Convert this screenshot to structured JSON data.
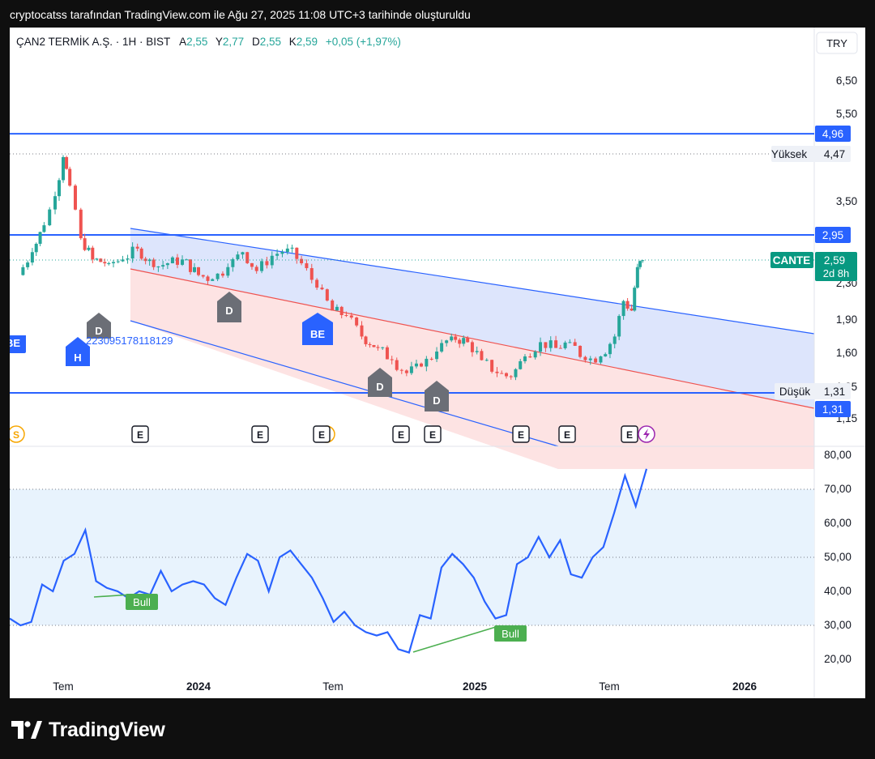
{
  "header": {
    "text": "cryptocatss tarafından TradingView.com ile Ağu 27, 2025 11:08 UTC+3 tarihinde oluşturuldu"
  },
  "brand": {
    "name": "TradingView",
    "icon": "tradingview-logo-icon"
  },
  "chart_data": [
    {
      "type": "candlestick",
      "symbol_line": {
        "name": "ÇAN2 TERMİK A.Ş. · 1H · BIST",
        "open_label": "A",
        "open": "2,55",
        "high_label": "Y",
        "high": "2,77",
        "low_label": "D",
        "low": "2,55",
        "close_label": "K",
        "close": "2,59",
        "change": "+0,05 (+1,97%)"
      },
      "currency": "TRY",
      "y_scale": "log",
      "y_ticks": [
        "6,50",
        "5,50",
        "3,50",
        "2,30",
        "1,90",
        "1,60",
        "1,35",
        "1,15"
      ],
      "x_ticks": [
        "Tem",
        "2024",
        "Tem",
        "2025",
        "Tem",
        "2026"
      ],
      "horizontal_lines": [
        {
          "value": 4.96,
          "label": "4,96",
          "color": "#2962ff"
        },
        {
          "value": 2.95,
          "label": "2,95",
          "color": "#2962ff"
        },
        {
          "value": 1.31,
          "label": "1,31",
          "color": "#2962ff"
        }
      ],
      "price_markers": [
        {
          "name": "Yüksek",
          "value": 4.47,
          "label": "4,47"
        },
        {
          "name": "Düşük",
          "value": 1.31,
          "label": "1,31"
        }
      ],
      "last_price": {
        "ticker": "CANTE",
        "value": 2.59,
        "label": "2,59",
        "countdown": "2d 8h"
      },
      "annotation_number": "223095178118129",
      "channel_markers": [
        {
          "label": "BE",
          "kind": "blue"
        },
        {
          "label": "H",
          "kind": "blue"
        },
        {
          "label": "D",
          "kind": "gray"
        },
        {
          "label": "D",
          "kind": "gray"
        },
        {
          "label": "BE",
          "kind": "blue"
        },
        {
          "label": "D",
          "kind": "gray"
        },
        {
          "label": "D",
          "kind": "gray"
        }
      ],
      "event_markers": [
        "S",
        "E",
        "E",
        "E",
        "E",
        "E",
        "E",
        "E",
        "E"
      ],
      "close_series": [
        {
          "date": "2023-05-01",
          "close": 2.4
        },
        {
          "date": "2023-05-20",
          "close": 2.7
        },
        {
          "date": "2023-06-05",
          "close": 3.1
        },
        {
          "date": "2023-06-20",
          "close": 3.6
        },
        {
          "date": "2023-07-01",
          "close": 4.4
        },
        {
          "date": "2023-07-10",
          "close": 3.8
        },
        {
          "date": "2023-07-25",
          "close": 2.9
        },
        {
          "date": "2023-08-10",
          "close": 2.6
        },
        {
          "date": "2023-09-01",
          "close": 2.55
        },
        {
          "date": "2023-09-20",
          "close": 2.6
        },
        {
          "date": "2023-10-10",
          "close": 2.75
        },
        {
          "date": "2023-11-01",
          "close": 2.5
        },
        {
          "date": "2023-11-20",
          "close": 2.55
        },
        {
          "date": "2023-12-10",
          "close": 2.6
        },
        {
          "date": "2024-01-01",
          "close": 2.4
        },
        {
          "date": "2024-01-20",
          "close": 2.35
        },
        {
          "date": "2024-02-10",
          "close": 2.5
        },
        {
          "date": "2024-03-01",
          "close": 2.7
        },
        {
          "date": "2024-03-20",
          "close": 2.45
        },
        {
          "date": "2024-04-10",
          "close": 2.65
        },
        {
          "date": "2024-05-01",
          "close": 2.75
        },
        {
          "date": "2024-05-20",
          "close": 2.55
        },
        {
          "date": "2024-06-10",
          "close": 2.25
        },
        {
          "date": "2024-07-01",
          "close": 2.0
        },
        {
          "date": "2024-07-20",
          "close": 1.95
        },
        {
          "date": "2024-08-10",
          "close": 1.75
        },
        {
          "date": "2024-09-01",
          "close": 1.65
        },
        {
          "date": "2024-09-20",
          "close": 1.55
        },
        {
          "date": "2024-10-10",
          "close": 1.45
        },
        {
          "date": "2024-10-30",
          "close": 1.5
        },
        {
          "date": "2024-11-20",
          "close": 1.62
        },
        {
          "date": "2024-12-10",
          "close": 1.75
        },
        {
          "date": "2025-01-01",
          "close": 1.7
        },
        {
          "date": "2025-01-20",
          "close": 1.55
        },
        {
          "date": "2025-02-10",
          "close": 1.45
        },
        {
          "date": "2025-03-01",
          "close": 1.42
        },
        {
          "date": "2025-03-20",
          "close": 1.58
        },
        {
          "date": "2025-04-10",
          "close": 1.7
        },
        {
          "date": "2025-05-01",
          "close": 1.65
        },
        {
          "date": "2025-05-20",
          "close": 1.7
        },
        {
          "date": "2025-06-10",
          "close": 1.55
        },
        {
          "date": "2025-07-01",
          "close": 1.58
        },
        {
          "date": "2025-07-20",
          "close": 1.75
        },
        {
          "date": "2025-08-01",
          "close": 2.1
        },
        {
          "date": "2025-08-12",
          "close": 2.0
        },
        {
          "date": "2025-08-20",
          "close": 2.5
        },
        {
          "date": "2025-08-27",
          "close": 2.59
        }
      ]
    },
    {
      "type": "line",
      "name": "RSI",
      "y_ticks": [
        "80,00",
        "70,00",
        "60,00",
        "50,00",
        "40,00",
        "30,00",
        "20,00"
      ],
      "bands": [
        30,
        50,
        70
      ],
      "ylim": [
        18,
        82
      ],
      "divergence_labels": [
        "Bull",
        "Bull"
      ],
      "values": [
        32,
        30,
        31,
        42,
        40,
        49,
        51,
        58,
        43,
        41,
        40,
        38,
        40,
        39,
        46,
        40,
        42,
        43,
        42,
        38,
        36,
        44,
        51,
        49,
        40,
        50,
        52,
        48,
        44,
        38,
        31,
        34,
        30,
        28,
        27,
        28,
        23,
        22,
        33,
        32,
        47,
        51,
        48,
        44,
        37,
        32,
        33,
        48,
        50,
        56,
        50,
        55,
        45,
        44,
        50,
        53,
        63,
        74,
        65,
        76
      ]
    }
  ],
  "colors": {
    "blue_line": "#2962ff",
    "up_candle": "#26a69a",
    "down_candle": "#ef5350",
    "rsi_line": "#2962ff",
    "channel_blue": "#dbe4fb",
    "channel_red": "#fde1e1",
    "rsi_band": "#e8f3fd",
    "divergence_green": "#4caf50",
    "marker_gray": "#6b6e76"
  }
}
